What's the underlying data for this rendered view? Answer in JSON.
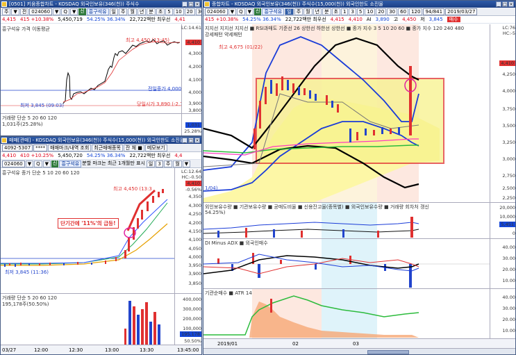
{
  "win1": {
    "title": "[0501] 키움종합차트 - KOSDAQ 외국인보유(346(천)) 주식수",
    "toolbar": [
      "주",
      "▼",
      "전",
      "024060",
      "▼",
      "Q",
      "▼",
      "신",
      "흥구석유",
      "일",
      "주",
      "월",
      "년",
      "분",
      "초",
      "5",
      "10",
      "20",
      "30",
      "60",
      "120"
    ],
    "quote": {
      "price": "4,415",
      "chg": "415 +10.38%",
      "vol": "5,450,719",
      "pct": "54.25% 36.34%",
      "amt": "22,722백만 최우선",
      "last": "4,41"
    },
    "legend": "흥구석유 가격 이동평균",
    "annot_high": "최고 4,450 (13:45)",
    "annot_low": "최저 3,845 (09:03)",
    "annot_prev": "전일종가 4,000",
    "annot_open": "당일시가 3,890 (-2.75%)",
    "axis": [
      "LC:14.61",
      "4,410",
      "4,300",
      "4,200",
      "4,100",
      "4,000",
      "3,900",
      "3,800"
    ],
    "vol_legend": "거래량 단순 5 20 60 120",
    "vol_value": "1,031주(25.28%)",
    "vol_axis": [
      "1,031",
      "25.28%"
    ]
  },
  "win2": {
    "title": "매매[관매] - KOSDAQ 외국인보유(346(천)) 주식수(15,000(천)) 외국인한도 소진율",
    "row1": {
      "acct": "4092-5307",
      "pw": "****",
      "btn1": "매매마크/내역 조회",
      "btn2": "최근매매종목",
      "btn3": "잔 체 ■",
      "btn4": "메모보기"
    },
    "quote": {
      "price": "4,410",
      "chg": "410 +10.25%",
      "vol": "5,450,720",
      "pct": "54.25% 36.34%",
      "amt": "22,722백만 최우선",
      "last": "4,4"
    },
    "toolbar": [
      "024060",
      "▼",
      "Q",
      "▼",
      "신",
      "흥구석유",
      "분할 마크는 최근 1개월만 표시",
      "일",
      "3",
      "주",
      "월",
      "▼"
    ],
    "legend": "흥구석유 종가 단순 5 10 20 60 120",
    "annot_high": "최고 4,450 (13:3",
    "annot_low": "최저 3,845 (11:36)",
    "callout": "단기간에 '11%'의 급등!",
    "axis": [
      "LC:12.64",
      "HC:-0.50",
      "4,410",
      "-0.56%",
      "4,350",
      "4,300",
      "4,250",
      "4,200",
      "4,150",
      "4,100",
      "4,050",
      "4,000",
      "3,950",
      "3,900",
      "3,850"
    ],
    "vol_legend": "거래량 단순 5 20 60 120",
    "vol_value": "195,178주(50.50%)",
    "vol_axis": [
      "400,000",
      "300,000",
      "200,000",
      "100,000",
      "195,178",
      "50.50%"
    ],
    "time_axis": [
      "03/27",
      "12:00",
      "12:30",
      "13:00",
      "13:30",
      "13:45:00"
    ]
  },
  "win3": {
    "title": "종합차트 - KOSDAQ 외국인보유(346(천)) 주식수(15,000(천)) 외국인한도 소진율",
    "toolbar": [
      "024060",
      "▼",
      "Q",
      "▼",
      "신",
      "흥구석유",
      "일",
      "주",
      "월",
      "년",
      "분",
      "초",
      "1",
      "3",
      "5",
      "10",
      "20",
      "30",
      "60",
      "120",
      "94/841",
      "2019/03/27"
    ],
    "quote": {
      "price": "415 +10.38%",
      "pct": "54.25% 36.34%",
      "amt": "22,722백만 최우선",
      "v1": "4,415",
      "v2": "4,410",
      "v3": "AI",
      "v4": "3,890",
      "v5": "고",
      "v6": "4,450",
      "v7": "저",
      "v8": "3,845",
      "btn": "매수"
    },
    "legend1": "지지선 지지선 지지선 ■ RSI과매도 기준선 26 상한선 하한선 상한선 ■ 종가 지수 3 5 10 20 60 ■ 종가 지수 120 240 480",
    "legend2": "강세패턴 약세패턴",
    "annot_high": "최고 4,675 (01/22)",
    "annot_low": "1/04)",
    "axis": [
      "LC:76",
      "HC:-5",
      "4,410",
      "4,250",
      "4,000",
      "3,750",
      "3,500",
      "3,250",
      "3,000",
      "2,750",
      "2,500",
      "2,250"
    ],
    "sub1_legend": "외인보유수량 ■ 기관보유수량 ■ 공매도비율 ■ 신용잔고율(종목별) ■ 외국인보유수량 ■ 거래량 회차처 갱신",
    "sub1_value": "54.25%)",
    "sub1_axis": [
      "20,000",
      "10,000",
      "5,451",
      "0"
    ],
    "sub2_legend": "DI Minus ADX ■ 외국인매수",
    "sub2_axis": [
      "40.00",
      "30.00",
      "20.00",
      "10.00"
    ],
    "sub3_legend": "기관순매수 ■ ATR 14",
    "sub3_axis": [
      "40.00",
      "30.00",
      "20.00",
      "10.00"
    ],
    "time_axis": [
      "2019/01",
      "02",
      "03"
    ]
  }
}
